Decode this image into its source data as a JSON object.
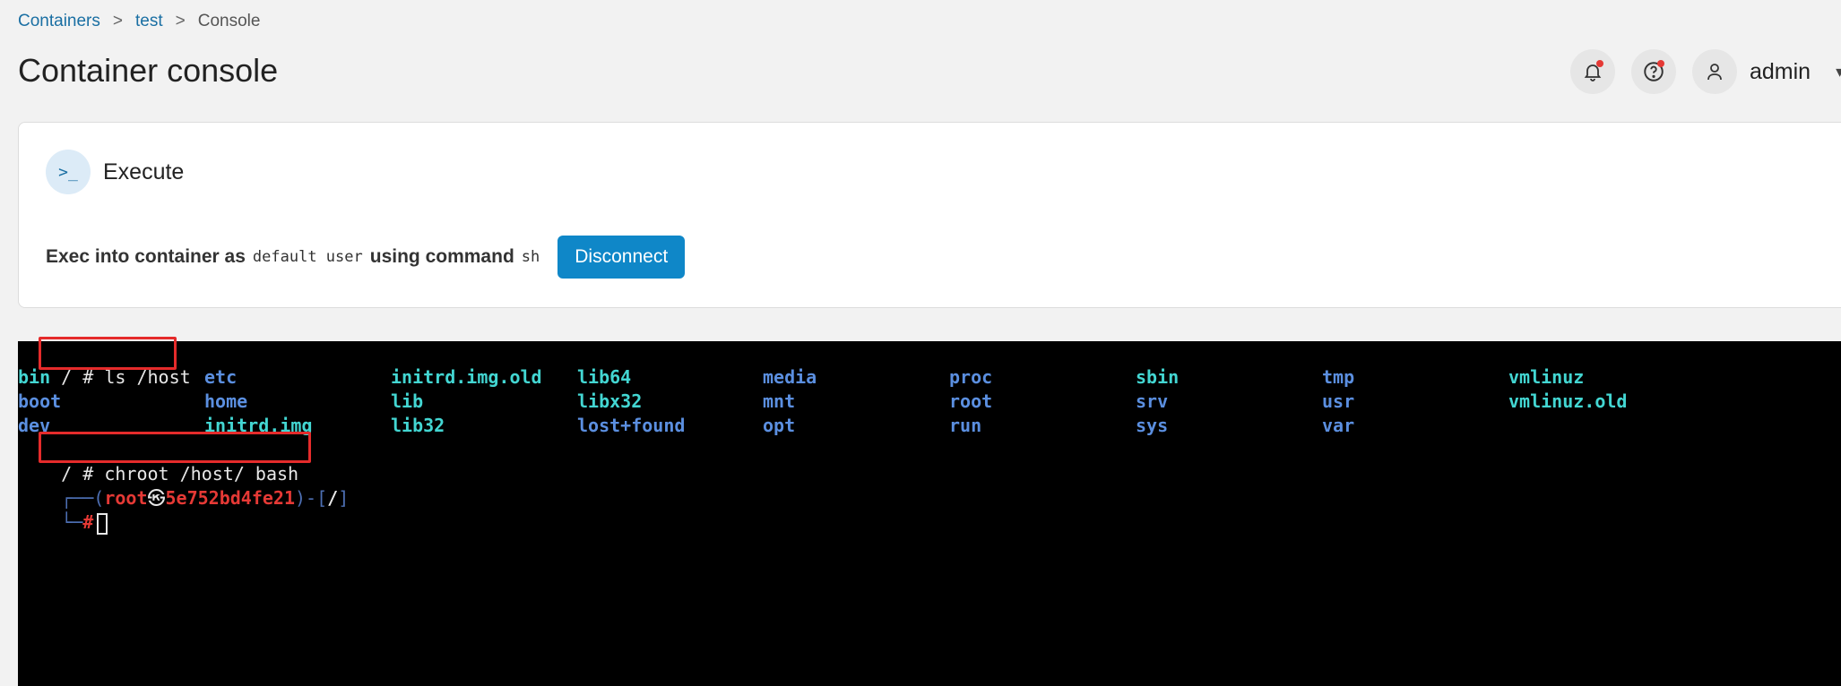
{
  "breadcrumb": {
    "item1": "Containers",
    "sep1": ">",
    "item2": "test",
    "sep2": ">",
    "current": "Console"
  },
  "page": {
    "title": "Container console"
  },
  "header": {
    "user_name": "admin",
    "caret": "▾"
  },
  "execute": {
    "title": "Execute",
    "icon": ">_",
    "label_prefix": "Exec into container as",
    "user": "default user",
    "label_mid": "using command",
    "command": "sh",
    "button_label": "Disconnect"
  },
  "terminal": {
    "line1_prompt": "/ ",
    "line1_cmd": "# ls /host",
    "ls_rows": [
      [
        "bin",
        "etc",
        "initrd.img.old",
        "lib64",
        "media",
        "proc",
        "sbin",
        "tmp",
        "vmlinuz"
      ],
      [
        "boot",
        "home",
        "lib",
        "libx32",
        "mnt",
        "root",
        "srv",
        "usr",
        "vmlinuz.old"
      ],
      [
        "dev",
        "initrd.img",
        "lib32",
        "lost+found",
        "opt",
        "run",
        "sys",
        "var",
        ""
      ]
    ],
    "line5_prompt": "/ ",
    "line5_cmd": "# chroot /host/ bash",
    "prompt_prefix": "┌──(",
    "prompt_user": "root",
    "prompt_at": "㉿",
    "prompt_host": "5e752bd4fe21",
    "prompt_mid": ")-[",
    "prompt_path": "/",
    "prompt_end": "]",
    "prompt2_prefix": "└─",
    "prompt2_hash": "#"
  },
  "colors": {
    "accent": "#0f87c8",
    "terminal_bg": "#000000",
    "dir": "#5b8fe0",
    "exe": "#43d6d2",
    "highlight": "#e52b2b"
  }
}
